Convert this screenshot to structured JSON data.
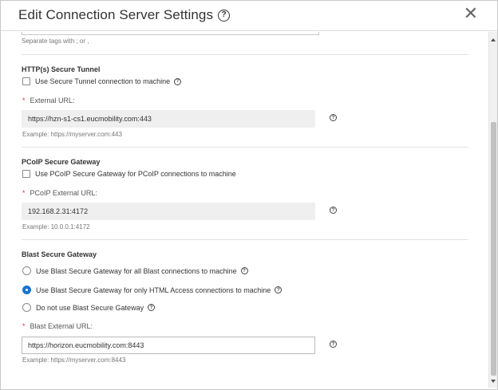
{
  "dialog": {
    "title": "Edit Connection Server Settings",
    "close_glyph": "✕"
  },
  "tags": {
    "hint": "Separate tags with ; or ,"
  },
  "http_tunnel": {
    "section_title": "HTTP(s) Secure Tunnel",
    "checkbox_label": "Use Secure Tunnel connection to machine",
    "checkbox_checked": false,
    "field_label": "External URL:",
    "value": "https://hzn-s1-cs1.eucmobility.com:443",
    "example": "Example: https://myserver.com:443"
  },
  "pcoip": {
    "section_title": "PCoIP Secure Gateway",
    "checkbox_label": "Use PCoIP Secure Gateway for PCoIP connections to machine",
    "checkbox_checked": false,
    "field_label": "PCoIP External URL:",
    "value": "192.168.2.31:4172",
    "example": "Example: 10.0.0.1:4172"
  },
  "blast": {
    "section_title": "Blast Secure Gateway",
    "options": [
      {
        "label": "Use Blast Secure Gateway for all Blast connections to machine",
        "selected": false
      },
      {
        "label": "Use Blast Secure Gateway for only HTML Access connections to machine",
        "selected": true
      },
      {
        "label": "Do not use Blast Secure Gateway",
        "selected": false
      }
    ],
    "field_label": "Blast External URL:",
    "value": "https://horizon.eucmobility.com:8443",
    "example": "Example: https://myserver.com:8443"
  },
  "required_marker": "*",
  "help_glyph": "?",
  "colors": {
    "accent": "#1a73d0",
    "required": "#d0343a",
    "disabled_field": "#efefef"
  }
}
